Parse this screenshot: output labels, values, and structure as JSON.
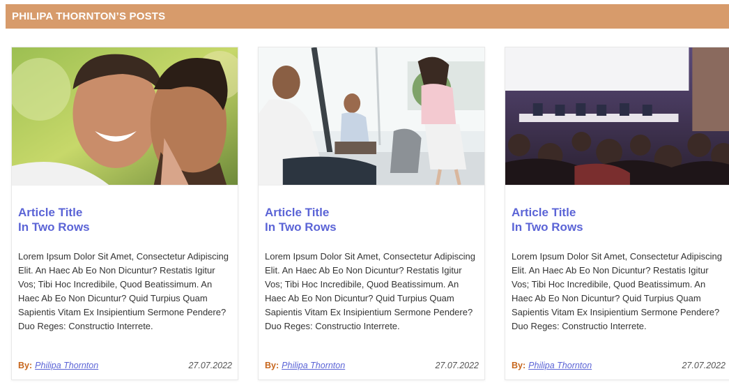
{
  "header": {
    "title": "PHILIPA THORNTON’S POSTS"
  },
  "posts": [
    {
      "image": "couple-smiling-photo",
      "title_line1": "Article Title",
      "title_line2": "In Two Rows",
      "excerpt": "Lorem Ipsum Dolor Sit Amet, Consectetur Adipiscing Elit. An Haec Ab Eo Non Dicuntur? Restatis Igitur Vos; Tibi Hoc Incredibile, Quod Beatissimum. An Haec Ab Eo Non Dicuntur? Quid Turpius Quam Sapientis Vitam Ex Insipientium Sermone Pendere? Duo Reges: Constructio Interrete.",
      "by_label": "By:",
      "author": "Philipa Thornton",
      "date": "27.07.2022"
    },
    {
      "image": "business-meeting-photo",
      "title_line1": "Article Title",
      "title_line2": "In Two Rows",
      "excerpt": "Lorem Ipsum Dolor Sit Amet, Consectetur Adipiscing Elit. An Haec Ab Eo Non Dicuntur? Restatis Igitur Vos; Tibi Hoc Incredibile, Quod Beatissimum. An Haec Ab Eo Non Dicuntur? Quid Turpius Quam Sapientis Vitam Ex Insipientium Sermone Pendere? Duo Reges: Constructio Interrete.",
      "by_label": "By:",
      "author": "Philipa Thornton",
      "date": "27.07.2022"
    },
    {
      "image": "conference-audience-photo",
      "title_line1": "Article Title",
      "title_line2": "In Two Rows",
      "excerpt": "Lorem Ipsum Dolor Sit Amet, Consectetur Adipiscing Elit. An Haec Ab Eo Non Dicuntur? Restatis Igitur Vos; Tibi Hoc Incredibile, Quod Beatissimum. An Haec Ab Eo Non Dicuntur? Quid Turpius Quam Sapientis Vitam Ex Insipientium Sermone Pendere? Duo Reges: Constructio Interrete.",
      "by_label": "By:",
      "author": "Philipa Thornton",
      "date": "27.07.2022"
    }
  ],
  "colors": {
    "header_bg": "#d79b6b",
    "title": "#5b64d6",
    "by_label": "#c7661c"
  }
}
